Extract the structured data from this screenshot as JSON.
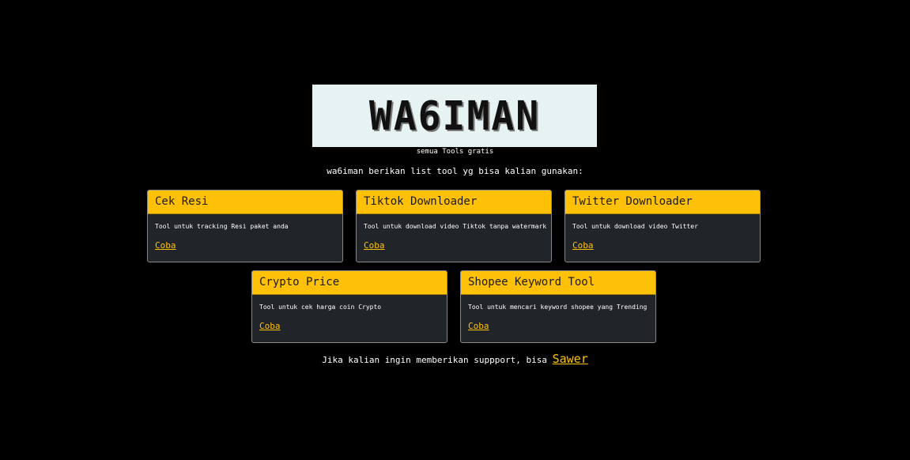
{
  "logo": {
    "text": "WA6IMAN"
  },
  "subtitle": "semua Tools gratis",
  "intro": "wa6iman berikan list tool yg bisa kalian gunakan:",
  "cards": [
    {
      "title": "Cek Resi",
      "description": "Tool untuk tracking Resi paket anda",
      "link": "Coba"
    },
    {
      "title": "Tiktok Downloader",
      "description": "Tool untuk download video Tiktok tanpa watermark",
      "link": "Coba"
    },
    {
      "title": "Twitter Downloader",
      "description": "Tool untuk download video Twitter",
      "link": "Coba"
    },
    {
      "title": "Crypto Price",
      "description": "Tool untuk cek harga coin Crypto",
      "link": "Coba"
    },
    {
      "title": "Shopee Keyword Tool",
      "description": "Tool untuk mencari keyword shopee yang Trending",
      "link": "Coba"
    }
  ],
  "footer": {
    "text": "Jika kalian ingin memberikan suppport, bisa",
    "link": "Sawer"
  },
  "colors": {
    "background": "#000000",
    "accent": "#ffc107",
    "card_body": "#212529",
    "logo_background": "#e6f3f2"
  }
}
